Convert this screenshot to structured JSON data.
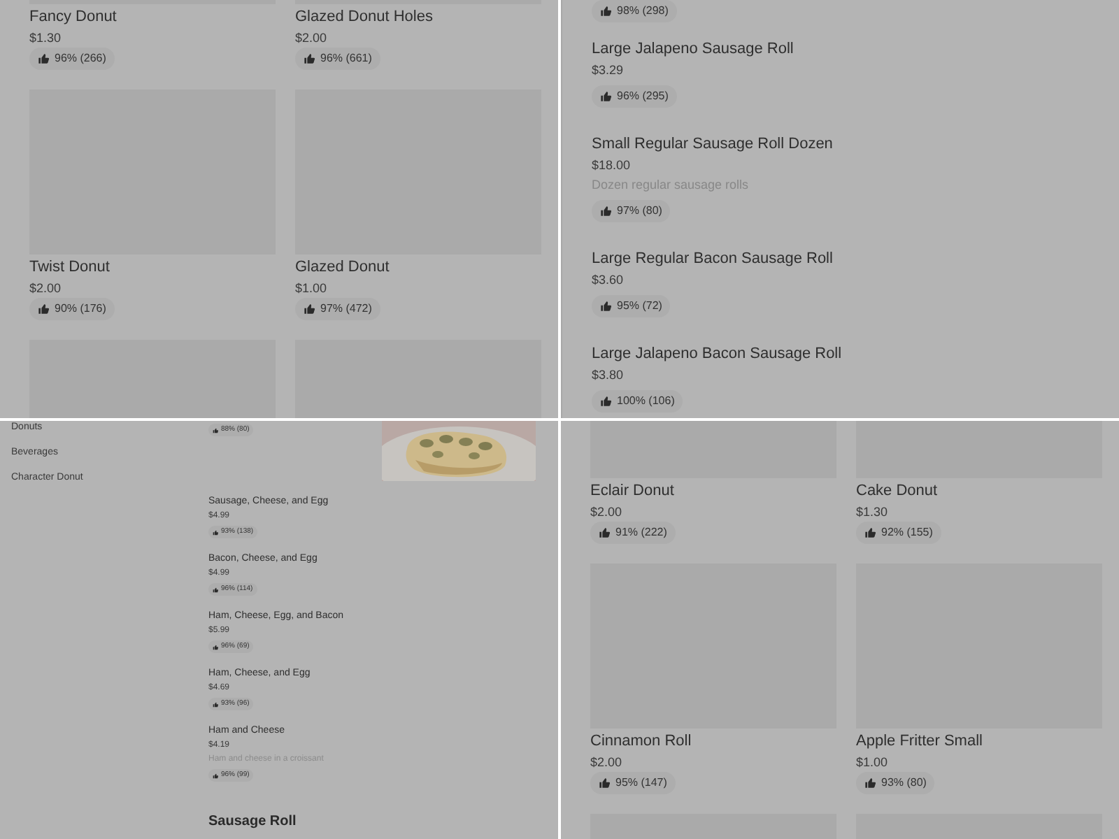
{
  "panels": [
    {
      "kind": "card_grid",
      "cards": [
        {
          "name": "Fancy Donut",
          "price": "$1.30",
          "rating": "96% (266)"
        },
        {
          "name": "Glazed Donut Holes",
          "price": "$2.00",
          "rating": "96% (661)"
        },
        {
          "name": "Twist Donut",
          "price": "$2.00",
          "rating": "90% (176)"
        },
        {
          "name": "Glazed Donut",
          "price": "$1.00",
          "rating": "97% (472)"
        }
      ]
    },
    {
      "kind": "item_list",
      "cut_rating": "98% (298)",
      "items": [
        {
          "name": "Large Jalapeno Sausage Roll",
          "price": "$3.29",
          "rating": "96% (295)"
        },
        {
          "name": "Small Regular Sausage Roll Dozen",
          "price": "$18.00",
          "description": "Dozen regular sausage rolls",
          "rating": "97% (80)"
        },
        {
          "name": "Large Regular Bacon Sausage Roll",
          "price": "$3.60",
          "rating": "95% (72)"
        },
        {
          "name": "Large Jalapeno Bacon Sausage Roll",
          "price": "$3.80",
          "rating": "100% (106)"
        }
      ]
    },
    {
      "kind": "menu_page",
      "categories": [
        "Donuts",
        "Beverages",
        "Character Donut"
      ],
      "cut_rating": "88% (80)",
      "items": [
        {
          "name": "Sausage, Cheese, and Egg",
          "price": "$4.99",
          "rating": "93% (138)"
        },
        {
          "name": "Bacon, Cheese, and Egg",
          "price": "$4.99",
          "rating": "96% (114)"
        },
        {
          "name": "Ham, Cheese, Egg, and Bacon",
          "price": "$5.99",
          "rating": "96% (69)"
        },
        {
          "name": "Ham, Cheese, and Egg",
          "price": "$4.69",
          "rating": "93% (96)"
        },
        {
          "name": "Ham and Cheese",
          "price": "$4.19",
          "description": "Ham and cheese in a croissant",
          "rating": "96% (99)"
        }
      ],
      "section_heading": "Sausage Roll"
    },
    {
      "kind": "card_grid",
      "cards": [
        {
          "name": "Eclair Donut",
          "price": "$2.00",
          "rating": "91% (222)"
        },
        {
          "name": "Cake Donut",
          "price": "$1.30",
          "rating": "92% (155)"
        },
        {
          "name": "Cinnamon Roll",
          "price": "$2.00",
          "rating": "95% (147)"
        },
        {
          "name": "Apple Fritter Small",
          "price": "$1.00",
          "rating": "93% (80)"
        }
      ]
    }
  ]
}
